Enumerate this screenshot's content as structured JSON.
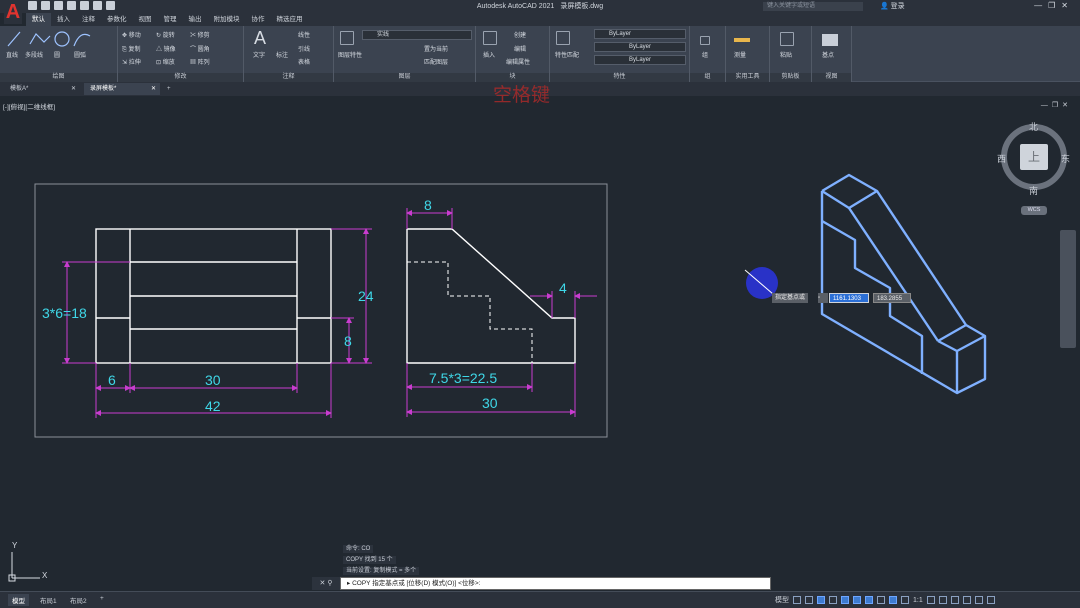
{
  "app": {
    "logo": "A",
    "title_app": "Autodesk AutoCAD 2021",
    "title_file": "录屏模板.dwg",
    "search_placeholder": "键入关键字或短语",
    "login": "登录"
  },
  "ribbon_tabs": [
    "默认",
    "插入",
    "注释",
    "参数化",
    "视图",
    "管理",
    "输出",
    "附加模块",
    "协作",
    "精选应用"
  ],
  "ribbon": {
    "draw": {
      "label": "绘图",
      "line": "直线",
      "polyline": "多段线",
      "circle": "圆",
      "arc": "圆弧"
    },
    "modify": {
      "label": "修改",
      "move": "移动",
      "rotate": "旋转",
      "trim": "修剪",
      "copy": "复制",
      "mirror": "镜像",
      "fillet": "圆角",
      "stretch": "拉伸",
      "scale": "缩放",
      "array": "阵列"
    },
    "annotation": {
      "label": "注释",
      "text": "文字",
      "dimension": "标注",
      "linear": "线性",
      "leader": "引线",
      "table": "表格"
    },
    "layers": {
      "label": "图层",
      "props": "图层特性",
      "layer_name": "实线",
      "set_current": "置为当前",
      "match": "匹配图层"
    },
    "block": {
      "label": "块",
      "insert": "插入",
      "create": "创建",
      "edit": "编辑",
      "edit_attr": "编辑属性"
    },
    "properties": {
      "label": "特性",
      "match": "特性匹配",
      "color": "ByLayer",
      "linetype": "ByLayer",
      "lineweight": "ByLayer"
    },
    "groups": {
      "label": "组",
      "group": "组"
    },
    "utilities": {
      "label": "实用工具",
      "measure": "测量"
    },
    "clipboard": {
      "label": "剪贴板",
      "paste": "粘贴"
    },
    "view": {
      "label": "视图",
      "base": "基点"
    }
  },
  "file_tabs": [
    {
      "label": "模板A*"
    },
    {
      "label": "录屏模板*"
    }
  ],
  "viewport_label": "[-][俯视][二维线框]",
  "watermark": "空格键",
  "drawing": {
    "dims": {
      "d1": "3*6=18",
      "d2": "24",
      "d3": "8",
      "d4": "6",
      "d5": "30",
      "d6": "42",
      "d7": "8",
      "d8": "4",
      "d9": "7.5*3=22.5",
      "d10": "30"
    }
  },
  "tooltip": {
    "prompt": "指定基点或",
    "x_value": "1161.1303",
    "y_value": "183.2855"
  },
  "viewcube": {
    "north": "北",
    "south": "南",
    "east": "东",
    "west": "西",
    "face": "上",
    "wcs": "WCS"
  },
  "ucs": {
    "y": "Y",
    "x": "X"
  },
  "command": {
    "history": [
      "命令: CO",
      "COPY 找到 15 个",
      "当前设置:  复制模式 = 多个"
    ],
    "prompt": "COPY 指定基点或 [位移(D) 模式(O)] <位移>:"
  },
  "layout_tabs": [
    "模型",
    "布局1",
    "布局2"
  ],
  "status": {
    "model": "模型",
    "scale": "1:1"
  }
}
